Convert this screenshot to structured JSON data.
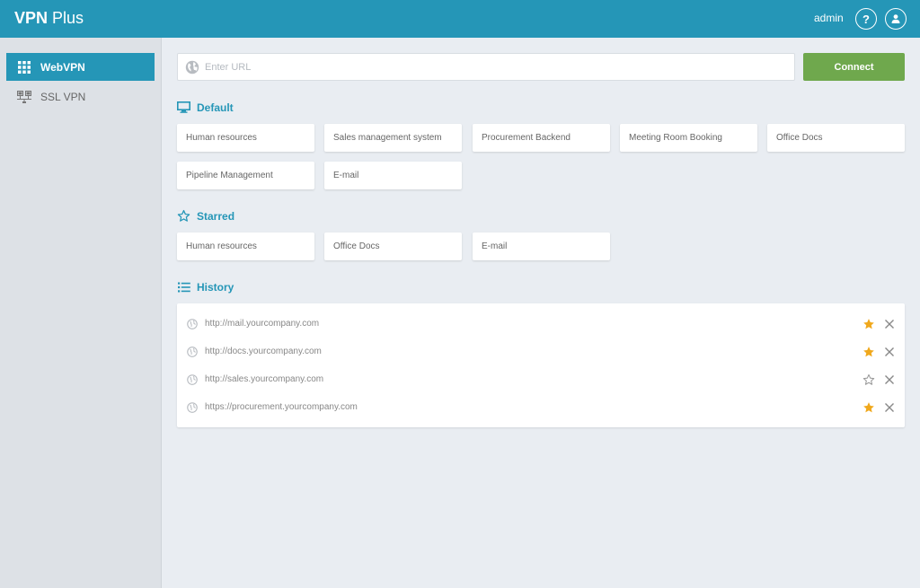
{
  "header": {
    "brand_bold": "VPN",
    "brand_light": "Plus",
    "user": "admin",
    "help_icon_glyph": "?"
  },
  "sidebar": {
    "items": [
      {
        "label": "WebVPN",
        "icon": "grid-icon",
        "active": true
      },
      {
        "label": "SSL VPN",
        "icon": "network-icon",
        "active": false
      }
    ]
  },
  "url_bar": {
    "placeholder": "Enter URL",
    "value": "",
    "connect_label": "Connect"
  },
  "sections": {
    "default": {
      "title": "Default",
      "tiles": [
        "Human resources",
        "Sales management system",
        "Procurement Backend",
        "Meeting Room Booking",
        "Office Docs",
        "Pipeline Management",
        "E-mail"
      ]
    },
    "starred": {
      "title": "Starred",
      "tiles": [
        "Human resources",
        "Office Docs",
        "E-mail"
      ]
    },
    "history": {
      "title": "History",
      "items": [
        {
          "url": "http://mail.yourcompany.com",
          "starred": true
        },
        {
          "url": "http://docs.yourcompany.com",
          "starred": true
        },
        {
          "url": "http://sales.yourcompany.com",
          "starred": false
        },
        {
          "url": "https://procurement.yourcompany.com",
          "starred": true
        }
      ]
    }
  },
  "colors": {
    "accent": "#2596b7",
    "connect": "#6fa84d",
    "star_filled": "#f0a81c",
    "star_empty": "#999999"
  }
}
